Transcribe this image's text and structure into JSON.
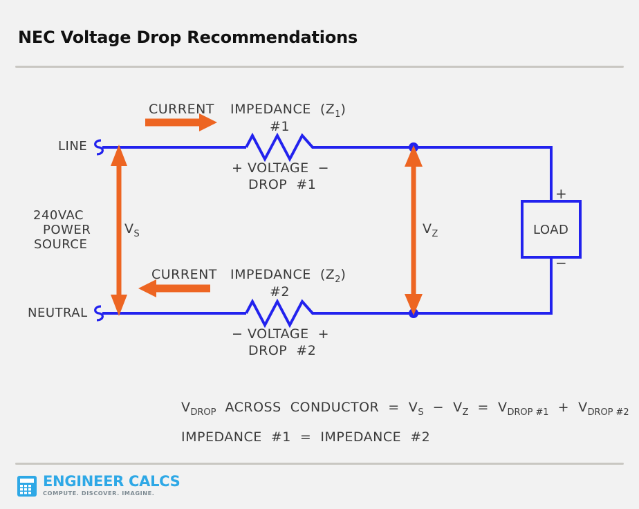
{
  "header": {
    "title": "NEC Voltage Drop Recommendations"
  },
  "colors": {
    "background": "#f2f2f2",
    "wire_blue": "#2222ee",
    "arrow_orange": "#ed6522",
    "text_gray": "#3a3a3a",
    "rule_gray": "#c9c7c2",
    "logo_blue": "#2ea8e6",
    "logo_tagline_gray": "#7d8a92"
  },
  "circuit": {
    "current_top_label": "CURRENT",
    "impedance_top_label": "IMPEDANCE  (Z",
    "impedance_top_sub": "1",
    "impedance_top_close": ")",
    "impedance_top_number": "#1",
    "line_terminal_label": "LINE",
    "voltage_drop_top_polarity": "+ VOLTAGE  −",
    "voltage_drop_top_label": "DROP  #1",
    "source_line1": "240VAC",
    "source_line2": "POWER",
    "source_line3": "SOURCE",
    "vs_label": "V",
    "vs_sub": "S",
    "vz_label": "V",
    "vz_sub": "Z",
    "load_label": "LOAD",
    "load_plus": "+",
    "load_minus": "−",
    "current_bottom_label": "CURRENT",
    "impedance_bottom_label": "IMPEDANCE  (Z",
    "impedance_bottom_sub": "2",
    "impedance_bottom_close": ")",
    "impedance_bottom_number": "#2",
    "neutral_terminal_label": "NEUTRAL",
    "voltage_drop_bottom_polarity": "− VOLTAGE  +",
    "voltage_drop_bottom_label": "DROP  #2"
  },
  "equations": {
    "line1_part1": "V",
    "line1_sub1": "DROP",
    "line1_part2": "  ACROSS  CONDUCTOR  =  V",
    "line1_sub2": "S",
    "line1_part3": "  −  V",
    "line1_sub3": "Z",
    "line1_part4": "  =  V",
    "line1_sub4": "DROP #1",
    "line1_part5": "  +  V",
    "line1_sub5": "DROP #2",
    "line2": "IMPEDANCE  #1  =  IMPEDANCE  #2"
  },
  "footer": {
    "logo_name": "ENGINEER CALCS",
    "logo_tagline": "COMPUTE. DISCOVER. IMAGINE.",
    "logo_icon": "calculator-icon"
  }
}
